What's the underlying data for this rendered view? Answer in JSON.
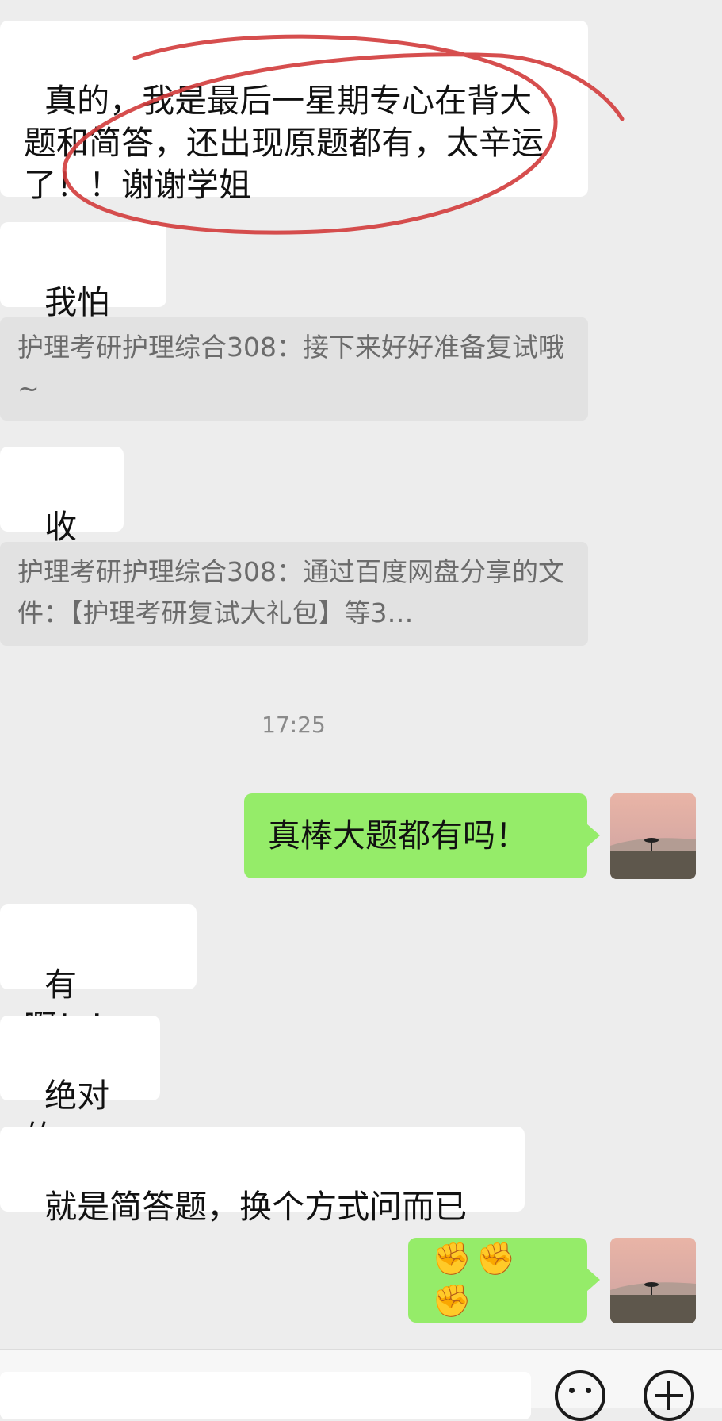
{
  "messages": {
    "m1": "真的，我是最后一星期专心在背大题和简答，还出现原题都有，太辛运了！！谢谢学姐",
    "m2_text": "我怕",
    "m2_emoji": "😭",
    "q1": "护理考研护理综合308：接下来好好准备复试哦~",
    "m3": "收到",
    "q2": "护理考研护理综合308：通过百度网盘分享的文件：【护理考研复试大礼包】等3…",
    "timestamp": "17:25",
    "me1": "真棒大题都有吗！",
    "m4": "有啊！！",
    "m5": "绝对的",
    "m6": "就是简答题，换个方式问而已",
    "me2": "✊✊✊"
  },
  "colors": {
    "background": "#ededed",
    "incoming_bubble": "#ffffff",
    "outgoing_bubble": "#95ec69",
    "quote_bubble": "#e2e2e2",
    "annotation_ink": "#d23b3b"
  },
  "icons": {
    "emoji_button": "smiley-icon",
    "plus_button": "plus-circle-icon",
    "avatar": "landscape-avatar"
  }
}
